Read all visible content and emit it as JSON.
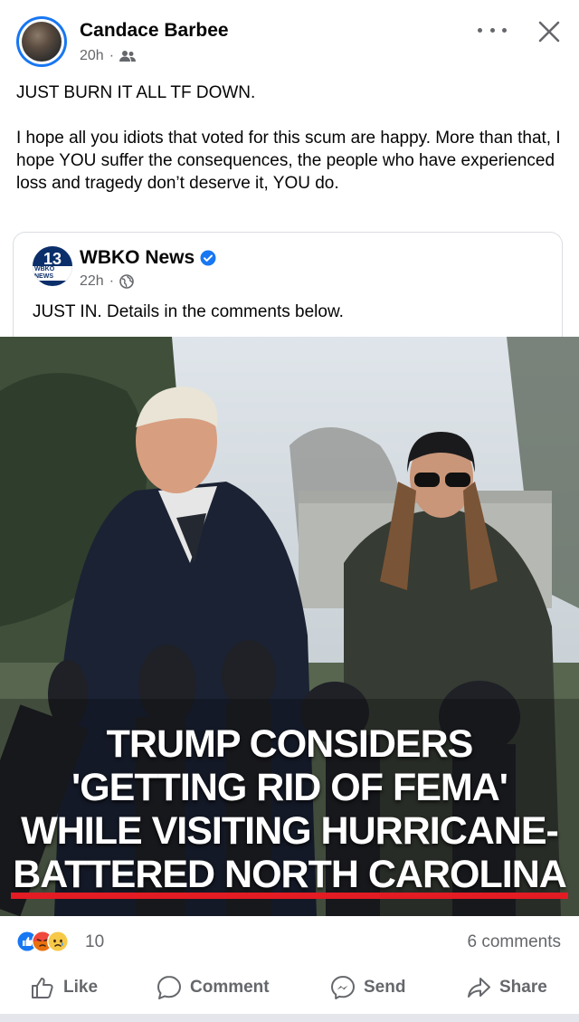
{
  "post": {
    "author": "Candace Barbee",
    "time": "20h",
    "separator": "·",
    "audience_icon": "friends-icon",
    "text": [
      "JUST BURN IT ALL TF DOWN.",
      "I hope all you idiots that voted for this scum are happy. More than that, I hope YOU suffer the consequences, the people who have experienced loss and tragedy don’t deserve it, YOU do."
    ]
  },
  "shared": {
    "source_name": "WBKO News",
    "logo_number": "13",
    "logo_text": "WBKO NEWS",
    "time": "22h",
    "separator": "·",
    "audience_icon": "globe-icon",
    "text": "JUST IN. Details in the comments below.",
    "headline_lines": [
      "TRUMP CONSIDERS",
      "'GETTING RID OF FEMA'",
      "WHILE VISITING HURRICANE-",
      "BATTERED NORTH CAROLINA"
    ]
  },
  "engagement": {
    "reaction_count": "10",
    "comments": "6 comments",
    "reaction_icons": [
      "like-reaction-icon",
      "angry-reaction-icon",
      "sad-reaction-icon"
    ]
  },
  "actions": {
    "like": "Like",
    "comment": "Comment",
    "send": "Send",
    "share": "Share"
  },
  "colors": {
    "brand_blue": "#1877f2",
    "headline_red": "#e31b23",
    "secondary_text": "#65676b"
  }
}
